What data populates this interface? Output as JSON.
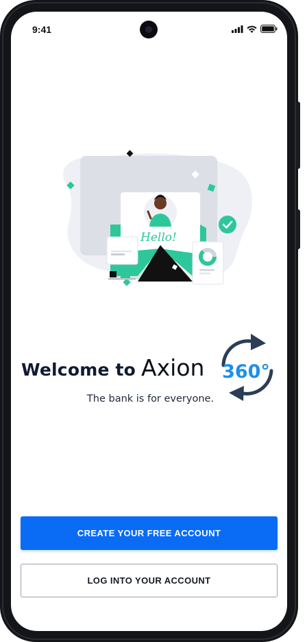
{
  "status_bar": {
    "time": "9:41",
    "icons": [
      "signal-icon",
      "wifi-icon",
      "battery-icon"
    ]
  },
  "hero": {
    "illustration": "envelope-hello-illustration",
    "illustration_text": "Hello!"
  },
  "welcome": {
    "prefix": "Welcome to",
    "brand": "Axion",
    "logo_text": "360°",
    "tagline": "The bank is for everyone."
  },
  "actions": {
    "create_account": "CREATE YOUR FREE ACCOUNT",
    "login": "LOG INTO YOUR ACCOUNT"
  },
  "colors": {
    "primary": "#0a6cf5",
    "accent": "#2ec79b",
    "dark_text": "#0f1b33",
    "logo_arrow": "#2c3e55"
  }
}
